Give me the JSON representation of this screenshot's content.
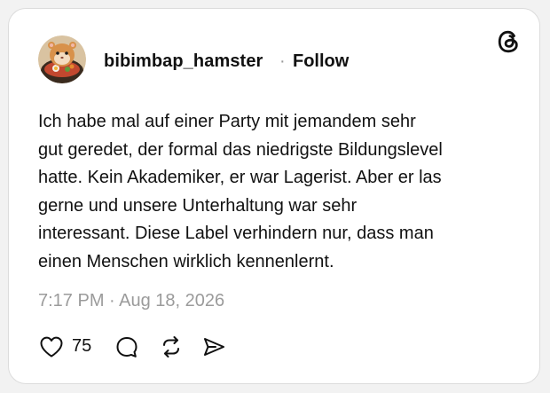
{
  "post": {
    "username": "bibimbap_hamster",
    "separator": "·",
    "follow_label": "Follow",
    "lines": [
      "Ich habe mal auf einer Party mit jemandem sehr",
      "gut geredet, der formal das niedrigste Bildungslevel",
      "hatte. Kein Akademiker, er war Lagerist. Aber er las",
      "gerne und unsere Unterhaltung war sehr",
      "interessant. Diese Label verhindern nur, dass man",
      "einen Menschen wirklich kennenlernt."
    ],
    "timestamp": "7:17 PM · Aug 18, 2026",
    "like_count": "75"
  },
  "icons": {
    "avatar": "hamster-bibimbap-avatar",
    "brand": "threads-logo-icon",
    "like": "heart-icon",
    "reply": "comment-bubble-icon",
    "repost": "repost-icon",
    "share": "send-icon"
  }
}
